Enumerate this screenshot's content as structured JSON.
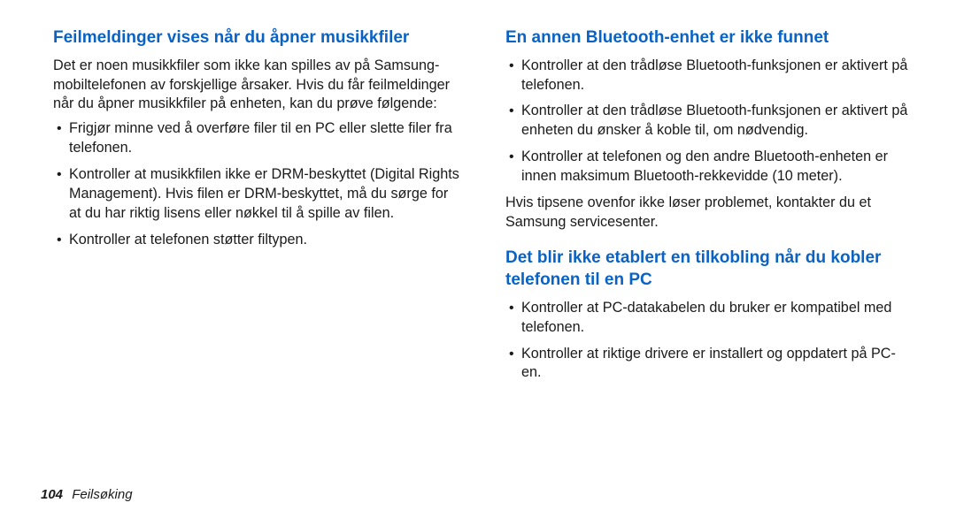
{
  "left": {
    "heading": "Feilmeldinger vises når du åpner musikkfiler",
    "intro": "Det er noen musikkfiler som ikke kan spilles av på Samsung-mobiltelefonen av forskjellige årsaker. Hvis du får feilmeldinger når du åpner musikkfiler på enheten, kan du prøve følgende:",
    "bullets": [
      "Frigjør minne ved å overføre filer til en PC eller slette filer fra telefonen.",
      "Kontroller at musikkfilen ikke er DRM-beskyttet (Digital Rights Management). Hvis filen er DRM-beskyttet, må du sørge for at du har riktig lisens eller nøkkel til å spille av filen.",
      "Kontroller at telefonen støtter filtypen."
    ]
  },
  "right": {
    "heading1": "En annen Bluetooth-enhet er ikke funnet",
    "bullets1": [
      "Kontroller at den trådløse Bluetooth-funksjonen er aktivert på telefonen.",
      "Kontroller at den trådløse Bluetooth-funksjonen er aktivert på enheten du ønsker å koble til, om nødvendig.",
      "Kontroller at telefonen og den andre Bluetooth-enheten er innen maksimum Bluetooth-rekkevidde (10 meter)."
    ],
    "note1": "Hvis tipsene ovenfor ikke løser problemet, kontakter du et Samsung servicesenter.",
    "heading2": "Det blir ikke etablert en tilkobling når du kobler telefonen til en PC",
    "bullets2": [
      "Kontroller at PC-datakabelen du bruker er kompatibel med telefonen.",
      "Kontroller at riktige drivere er installert og oppdatert på PC-en."
    ]
  },
  "footer": {
    "page": "104",
    "section": "Feilsøking"
  }
}
